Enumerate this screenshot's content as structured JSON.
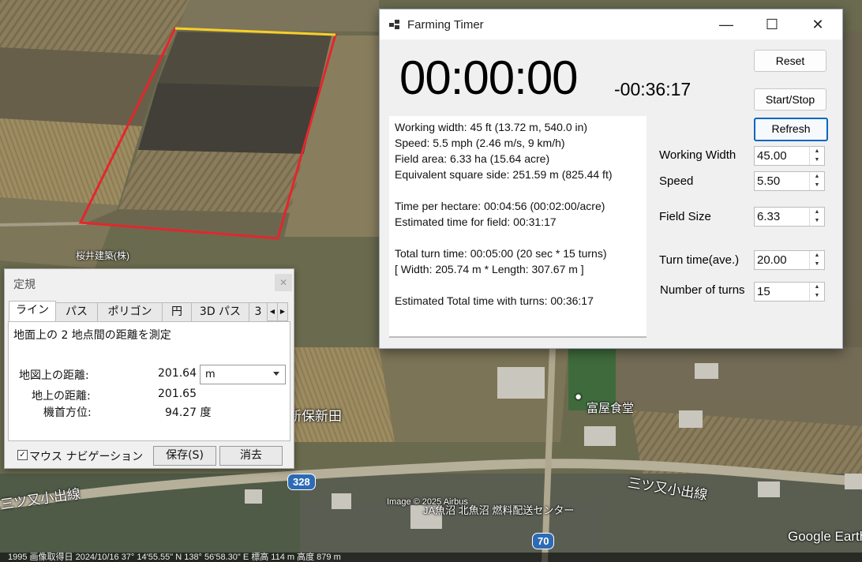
{
  "window": {
    "title": "Farming Timer",
    "minimize": "—",
    "maximize": "☐",
    "close": "✕"
  },
  "timer": {
    "main": "00:00:00",
    "remaining": "-00:36:17"
  },
  "buttons": {
    "reset": "Reset",
    "start_stop": "Start/Stop",
    "refresh": "Refresh"
  },
  "info_lines": [
    "Working width: 45 ft (13.72 m, 540.0 in)",
    "Speed: 5.5 mph (2.46 m/s, 9 km/h)",
    "Field area: 6.33 ha (15.64 acre)",
    "Equivalent square side: 251.59 m (825.44 ft)",
    "",
    "Time per hectare: 00:04:56 (00:02:00/acre)",
    "Estimated time for field: 00:31:17",
    "",
    "Total turn time: 00:05:00 (20 sec * 15 turns)",
    "[ Width: 205.74 m * Length: 307.67 m ]",
    "",
    "Estimated Total time with turns: 00:36:17"
  ],
  "fields": {
    "working_width": {
      "label": "Working Width",
      "value": "45.00"
    },
    "speed": {
      "label": "Speed",
      "value": "5.50"
    },
    "field_size": {
      "label": "Field Size",
      "value": "6.33"
    },
    "turn_time": {
      "label": "Turn time(ave.)",
      "value": "20.00"
    },
    "num_turns": {
      "label": "Number of turns",
      "value": "15"
    }
  },
  "ruler": {
    "title": "定規",
    "tabs": [
      "ライン",
      "パス",
      "ポリゴン",
      "円",
      "3D パス",
      "3"
    ],
    "description": "地面上の 2 地点間の距離を測定",
    "map_distance_label": "地図上の距離:",
    "map_distance_value": "201.64",
    "ground_distance_label": "地上の距離:",
    "ground_distance_value": "201.65",
    "heading_label": "機首方位:",
    "heading_value": "94.27 度",
    "unit": "m",
    "mouse_nav_label": "マウス ナビゲーション",
    "save_label": "保存(S)",
    "clear_label": "消去"
  },
  "map": {
    "labels": {
      "company": "桜井建築(株)",
      "area": "新保新田",
      "restaurant": "富屋食堂",
      "road_left": "三ツ又小出線",
      "road_right": "三ツ又小出線",
      "depot": "JA魚沼 北魚沼 燃料配送センター",
      "copyright": "Image © 2025 Airbus",
      "brand": "Google Earth"
    },
    "badges": {
      "route_a": "328",
      "route_b": "70"
    },
    "status": "1995   画像取得日 2024/10/16   37° 14'55.55\" N  138° 56'58.30\" E  標高  114 m   高度  879 m"
  },
  "colors": {
    "field_outline": "#e4262c",
    "ruler_line": "#f2d22a",
    "accent": "#0067c0"
  }
}
